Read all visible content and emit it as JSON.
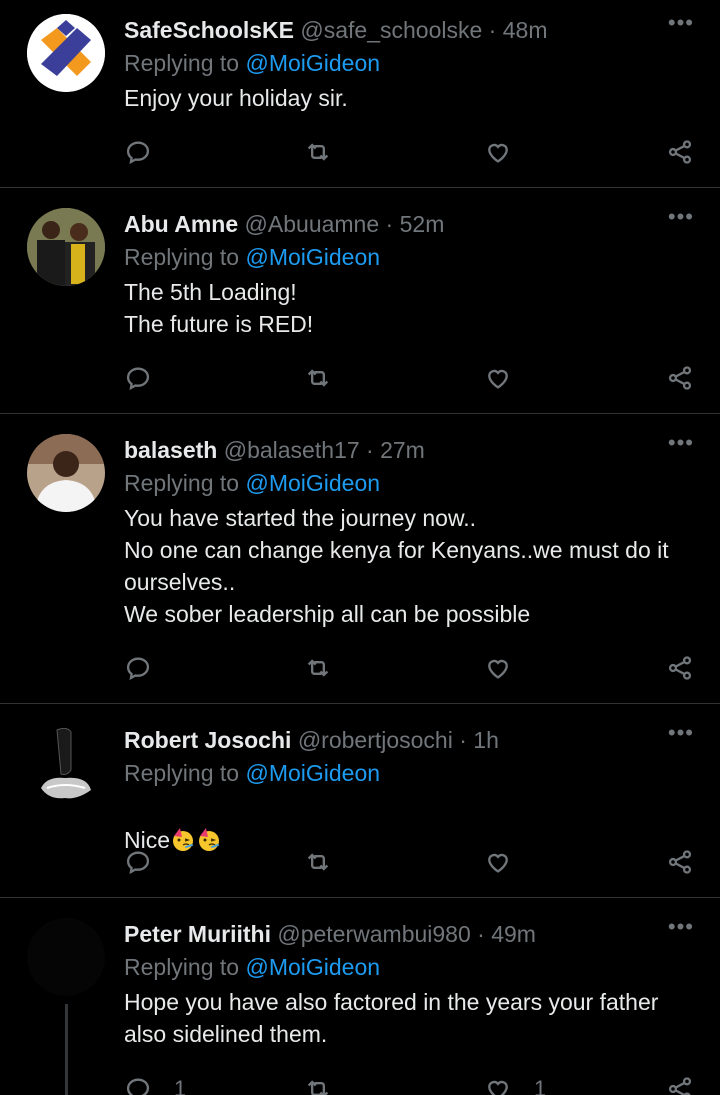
{
  "colors": {
    "background": "#000000",
    "text": "#e7e9ea",
    "muted": "#71767b",
    "link": "#1d9bf0",
    "divider": "#2f3336"
  },
  "more_label": "•••",
  "reply_prefix": "Replying to",
  "tweets": [
    {
      "name": "SafeSchoolsKE",
      "handle": "@safe_schoolske",
      "dot": "·",
      "time": "48m",
      "mention": "@MoiGideon",
      "text": "Enjoy your holiday sir.",
      "avatar": "safeschools-logo"
    },
    {
      "name": "Abu Amne",
      "handle": "@Abuuamne",
      "dot": "·",
      "time": "52m",
      "mention": "@MoiGideon",
      "text": "The 5th Loading!\nThe future is RED!",
      "avatar": "two-men-photo"
    },
    {
      "name": "balaseth",
      "handle": "@balaseth17",
      "dot": "·",
      "time": "27m",
      "mention": "@MoiGideon",
      "text": "You have started the journey now..\nNo one can change kenya for Kenyans..we must do it ourselves..\nWe sober leadership all can be possible",
      "avatar": "man-white-shirt-photo"
    },
    {
      "name": "Robert Josochi",
      "handle": "@robertjosochi",
      "dot": "·",
      "time": "1h",
      "mention": "@MoiGideon",
      "text": "Nice",
      "avatar": "robot-head-photo"
    },
    {
      "name": "Peter Muriithi",
      "handle": "@peterwambui980",
      "dot": "·",
      "time": "49m",
      "mention": "@MoiGideon",
      "text": "Hope you have also factored in the years your father also sidelined them.",
      "avatar": "dark-photo",
      "reply_count": "1",
      "like_count": "1"
    }
  ]
}
